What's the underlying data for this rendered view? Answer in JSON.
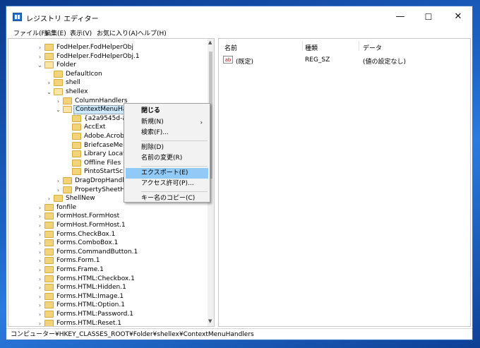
{
  "window": {
    "title": "レジストリ エディター",
    "minimize": "—",
    "maximize": "☐",
    "close": "✕"
  },
  "menu": [
    "ファイル(F)",
    "編集(E)",
    "表示(V)",
    "お気に入り(A)",
    "ヘルプ(H)"
  ],
  "tree": [
    {
      "label": "FodHelper.FodHelperObj",
      "depth": 0,
      "expander": "›"
    },
    {
      "label": "FodHelper.FodHelperObj.1",
      "depth": 0,
      "expander": "›"
    },
    {
      "label": "Folder",
      "depth": 0,
      "expander": "⌄"
    },
    {
      "label": "DefaultIcon",
      "depth": 1,
      "expander": ""
    },
    {
      "label": "shell",
      "depth": 1,
      "expander": "›"
    },
    {
      "label": "shellex",
      "depth": 1,
      "expander": "⌄"
    },
    {
      "label": "ColumnHandlers",
      "depth": 2,
      "expander": "›"
    },
    {
      "label": "ContextMenuHandlers",
      "depth": 2,
      "expander": "⌄"
    },
    {
      "label": "{a2a9545d-a0c2-4",
      "depth": 3,
      "expander": ""
    },
    {
      "label": "AccExt",
      "depth": 3,
      "expander": ""
    },
    {
      "label": "Adobe.Acrobat.Co",
      "depth": 3,
      "expander": ""
    },
    {
      "label": "BriefcaseMenu",
      "depth": 3,
      "expander": ""
    },
    {
      "label": "Library Location",
      "depth": 3,
      "expander": ""
    },
    {
      "label": "Offline Files",
      "depth": 3,
      "expander": ""
    },
    {
      "label": "PintoStartScreen",
      "depth": 3,
      "expander": ""
    },
    {
      "label": "DragDropHandlers",
      "depth": 2,
      "expander": "›"
    },
    {
      "label": "PropertySheetHandle",
      "depth": 2,
      "expander": "›"
    },
    {
      "label": "ShellNew",
      "depth": 1,
      "expander": "›"
    },
    {
      "label": "fonfile",
      "depth": 0,
      "expander": "›"
    },
    {
      "label": "FormHost.FormHost",
      "depth": 0,
      "expander": "›"
    },
    {
      "label": "FormHost.FormHost.1",
      "depth": 0,
      "expander": "›"
    },
    {
      "label": "Forms.CheckBox.1",
      "depth": 0,
      "expander": "›"
    },
    {
      "label": "Forms.ComboBox.1",
      "depth": 0,
      "expander": "›"
    },
    {
      "label": "Forms.CommandButton.1",
      "depth": 0,
      "expander": "›"
    },
    {
      "label": "Forms.Form.1",
      "depth": 0,
      "expander": "›"
    },
    {
      "label": "Forms.Frame.1",
      "depth": 0,
      "expander": "›"
    },
    {
      "label": "Forms.HTML:Checkbox.1",
      "depth": 0,
      "expander": "›"
    },
    {
      "label": "Forms.HTML:Hidden.1",
      "depth": 0,
      "expander": "›"
    },
    {
      "label": "Forms.HTML:Image.1",
      "depth": 0,
      "expander": "›"
    },
    {
      "label": "Forms.HTML:Option.1",
      "depth": 0,
      "expander": "›"
    },
    {
      "label": "Forms.HTML:Password.1",
      "depth": 0,
      "expander": "›"
    },
    {
      "label": "Forms.HTML:Reset.1",
      "depth": 0,
      "expander": "›"
    }
  ],
  "list": {
    "headers": {
      "name": "名前",
      "type": "種類",
      "data": "データ"
    },
    "rows": [
      {
        "icon": "ab",
        "name": "(既定)",
        "type": "REG_SZ",
        "data": "(値の設定なし)"
      }
    ]
  },
  "context_menu": {
    "items": [
      {
        "label": "閉じる",
        "bold": true
      },
      {
        "label": "新規(N)",
        "submenu": "›"
      },
      {
        "label": "検索(F)..."
      },
      {
        "sep": true
      },
      {
        "label": "削除(D)"
      },
      {
        "label": "名前の変更(R)"
      },
      {
        "sep": true
      },
      {
        "label": "エクスポート(E)",
        "highlight": true
      },
      {
        "label": "アクセス許可(P)..."
      },
      {
        "sep": true
      },
      {
        "label": "キー名のコピー(C)"
      }
    ]
  },
  "status": "コンピューター¥HKEY_CLASSES_ROOT¥Folder¥shellex¥ContextMenuHandlers",
  "colors": {
    "selection": "#cce8ff",
    "menu_highlight": "#91c9f7",
    "folder": "#f3d37a"
  }
}
